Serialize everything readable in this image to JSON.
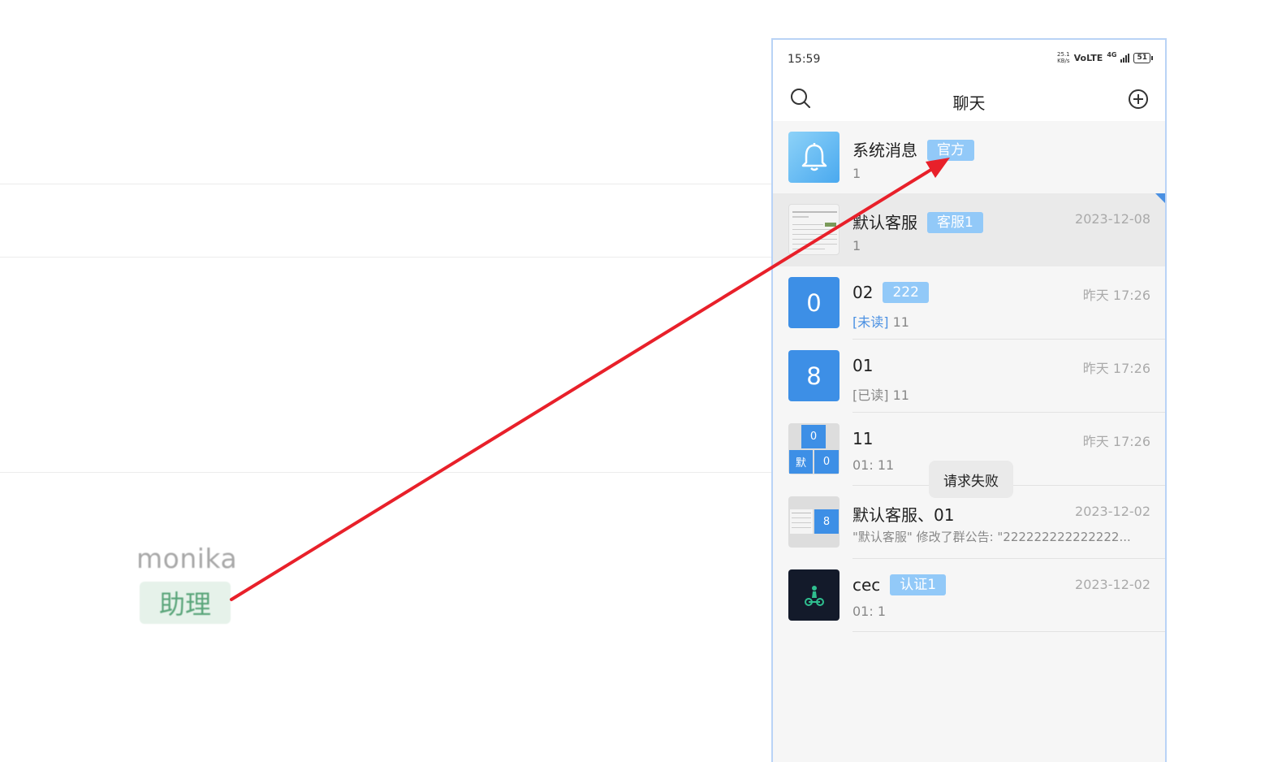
{
  "left_panel": {
    "name": "monika",
    "role_tag": "助理"
  },
  "statusbar": {
    "time": "15:59",
    "speed": "25.1",
    "speed_unit": "KB/s",
    "volte": "VoLTE",
    "network": "4G",
    "battery": "51"
  },
  "navbar": {
    "title": "聊天",
    "search_icon": "search-icon",
    "add_icon": "plus-circle-icon"
  },
  "chats": [
    {
      "name": "系统消息",
      "tag": "官方",
      "preview": "1",
      "time": ""
    },
    {
      "name": "默认客服",
      "tag": "客服1",
      "preview": "1",
      "time": "2023-12-08"
    },
    {
      "name": "02",
      "tag": "222",
      "preview_status": "[未读]",
      "preview": "11",
      "time": "昨天 17:26",
      "avatar_text": "0"
    },
    {
      "name": "01",
      "tag": "",
      "preview_status": "[已读]",
      "preview": "11",
      "time": "昨天 17:26",
      "avatar_text": "8"
    },
    {
      "name": "11",
      "tag": "",
      "preview": "01: 11",
      "time": "昨天 17:26",
      "avatar_cells": [
        "0",
        "默",
        "0"
      ]
    },
    {
      "name": "默认客服、01",
      "tag": "",
      "preview": "\"默认客服\" 修改了群公告: \"222222222222222...",
      "time": "2023-12-02",
      "avatar_cell": "8"
    },
    {
      "name": "cec",
      "tag": "认证1",
      "preview": "01: 1",
      "time": "2023-12-02"
    }
  ],
  "toast": "请求失败",
  "colors": {
    "accent": "#3d8fe6",
    "tag_bg": "#92c9f8",
    "annotation_arrow": "#e8202a",
    "left_tag_bg": "#e6f2ea"
  }
}
